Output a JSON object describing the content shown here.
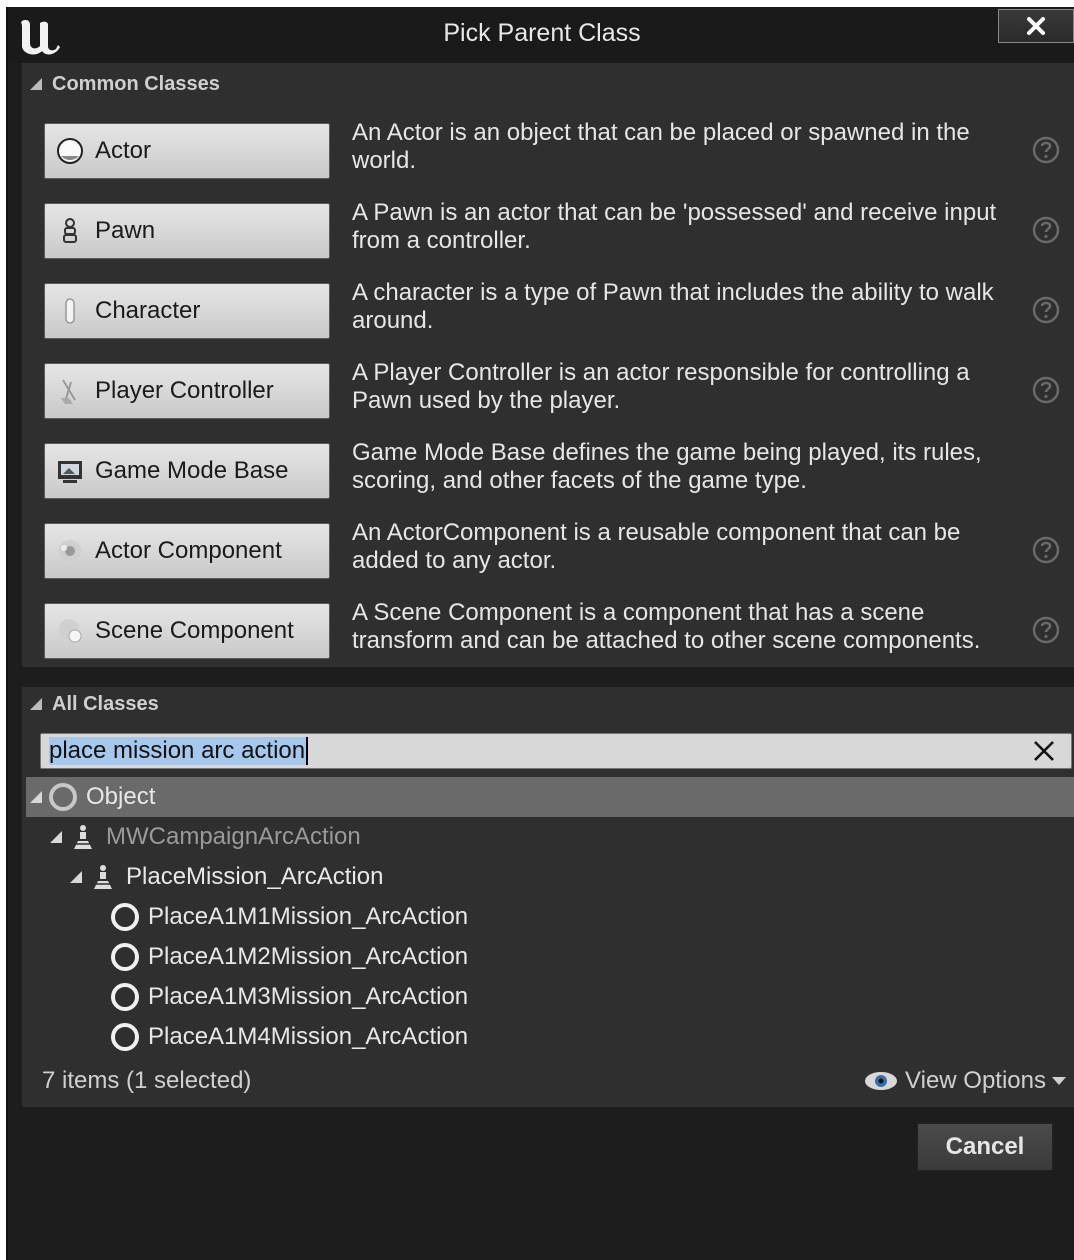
{
  "window": {
    "title": "Pick Parent Class",
    "close_label": "✕"
  },
  "common": {
    "header": "Common Classes",
    "items": [
      {
        "label": "Actor",
        "icon": "actor-icon",
        "description": "An Actor is an object that can be placed or spawned in the world.",
        "help": true
      },
      {
        "label": "Pawn",
        "icon": "pawn-icon",
        "description": "A Pawn is an actor that can be 'possessed' and receive input from a controller.",
        "help": true
      },
      {
        "label": "Character",
        "icon": "character-icon",
        "description": "A character is a type of Pawn that includes the ability to walk around.",
        "help": true
      },
      {
        "label": "Player Controller",
        "icon": "player-controller-icon",
        "description": "A Player Controller is an actor responsible for controlling a Pawn used by the player.",
        "help": true
      },
      {
        "label": "Game Mode Base",
        "icon": "game-mode-icon",
        "description": "Game Mode Base defines the game being played, its rules, scoring, and other facets of the game type.",
        "help": false
      },
      {
        "label": "Actor Component",
        "icon": "actor-component-icon",
        "description": "An ActorComponent is a reusable component that can be added to any actor.",
        "help": true
      },
      {
        "label": "Scene Component",
        "icon": "scene-component-icon",
        "description": "A Scene Component is a component that has a scene transform and can be attached to other scene components.",
        "help": true
      }
    ]
  },
  "all": {
    "header": "All Classes",
    "search_value": "place mission arc action",
    "tree": [
      {
        "label": "Object",
        "depth": 0,
        "expanded": true,
        "selected": true,
        "muted": false,
        "icon": "object-circle-icon"
      },
      {
        "label": "MWCampaignArcAction",
        "depth": 1,
        "expanded": true,
        "selected": false,
        "muted": true,
        "icon": "actor-class-icon"
      },
      {
        "label": "PlaceMission_ArcAction",
        "depth": 2,
        "expanded": true,
        "selected": false,
        "muted": false,
        "icon": "actor-class-icon"
      },
      {
        "label": "PlaceA1M1Mission_ArcAction",
        "depth": 3,
        "expanded": false,
        "selected": false,
        "muted": false,
        "icon": "object-circle-icon"
      },
      {
        "label": "PlaceA1M2Mission_ArcAction",
        "depth": 3,
        "expanded": false,
        "selected": false,
        "muted": false,
        "icon": "object-circle-icon"
      },
      {
        "label": "PlaceA1M3Mission_ArcAction",
        "depth": 3,
        "expanded": false,
        "selected": false,
        "muted": false,
        "icon": "object-circle-icon"
      },
      {
        "label": "PlaceA1M4Mission_ArcAction",
        "depth": 3,
        "expanded": false,
        "selected": false,
        "muted": false,
        "icon": "object-circle-icon"
      }
    ],
    "status": "7 items (1 selected)",
    "view_options": "View Options"
  },
  "footer": {
    "cancel_label": "Cancel"
  }
}
